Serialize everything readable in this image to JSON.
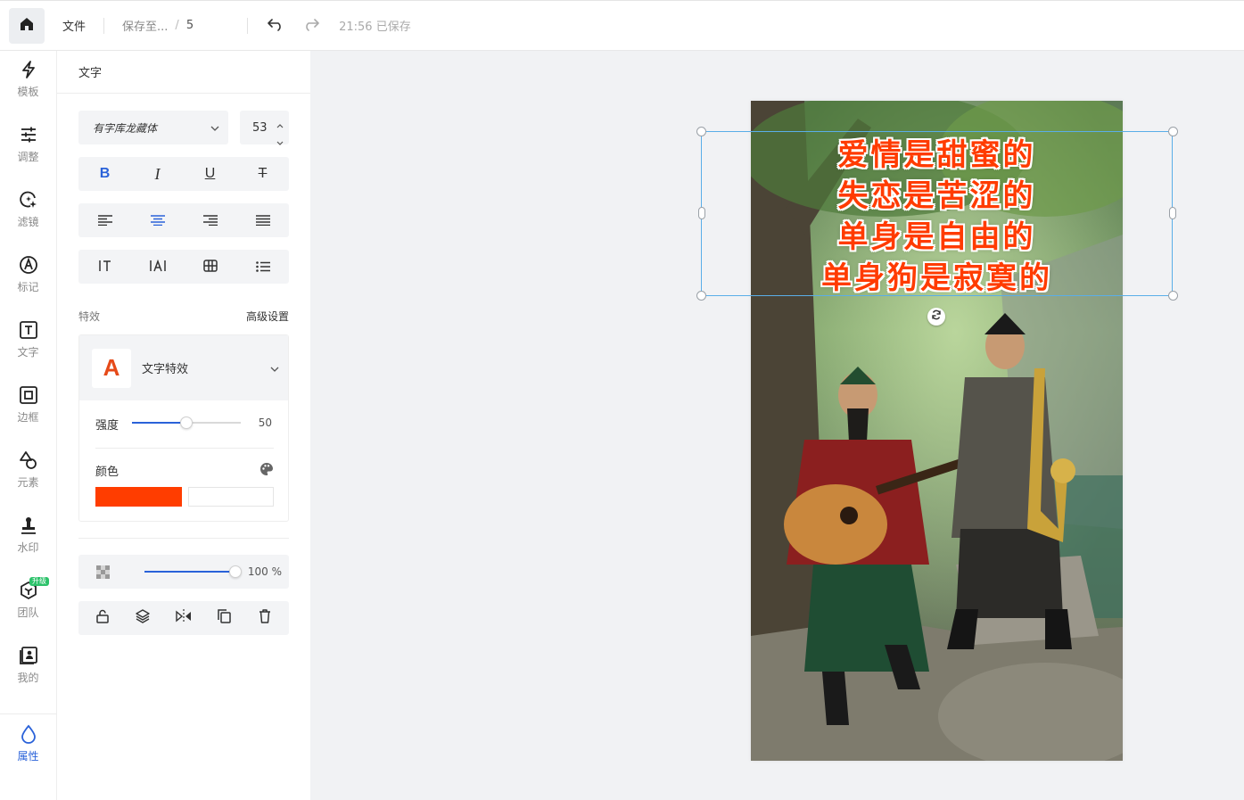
{
  "topbar": {
    "file_label": "文件",
    "breadcrumb_folder": "保存至...",
    "breadcrumb_sep": "/",
    "breadcrumb_name": "5",
    "saved_status": "21:56 已保存"
  },
  "rail": {
    "items": [
      {
        "label": "模板",
        "icon": "lightning-icon"
      },
      {
        "label": "调整",
        "icon": "sliders-icon"
      },
      {
        "label": "滤镜",
        "icon": "sparkle-circle-icon"
      },
      {
        "label": "标记",
        "icon": "pen-circle-icon"
      },
      {
        "label": "文字",
        "icon": "text-box-icon"
      },
      {
        "label": "边框",
        "icon": "frame-icon"
      },
      {
        "label": "元素",
        "icon": "shapes-icon"
      },
      {
        "label": "水印",
        "icon": "stamp-icon"
      },
      {
        "label": "团队",
        "icon": "cube-icon"
      },
      {
        "label": "我的",
        "icon": "profile-icon"
      },
      {
        "label": "属性",
        "icon": "drop-icon"
      }
    ],
    "upgrade_badge": "升级",
    "active_color": "#2a62d9"
  },
  "panel": {
    "title": "文字",
    "font_name": "有字库龙藏体",
    "font_size": "53",
    "effects_label": "特效",
    "advanced_label": "高级设置",
    "effect_name": "文字特效",
    "effect_icon_letter": "A",
    "strength_label": "强度",
    "strength_value": "50",
    "strength_fraction": 0.5,
    "color_label": "颜色",
    "color_primary": "#ff3d00",
    "opacity_value": "100 %",
    "opacity_fraction": 1.0
  },
  "canvas": {
    "poem_lines": [
      "爱情是甜蜜的",
      "失恋是苦涩的",
      "单身是自由的",
      "单身狗是寂寞的"
    ],
    "text_color": "#ff3b00",
    "selection_color": "#5aaee8"
  }
}
